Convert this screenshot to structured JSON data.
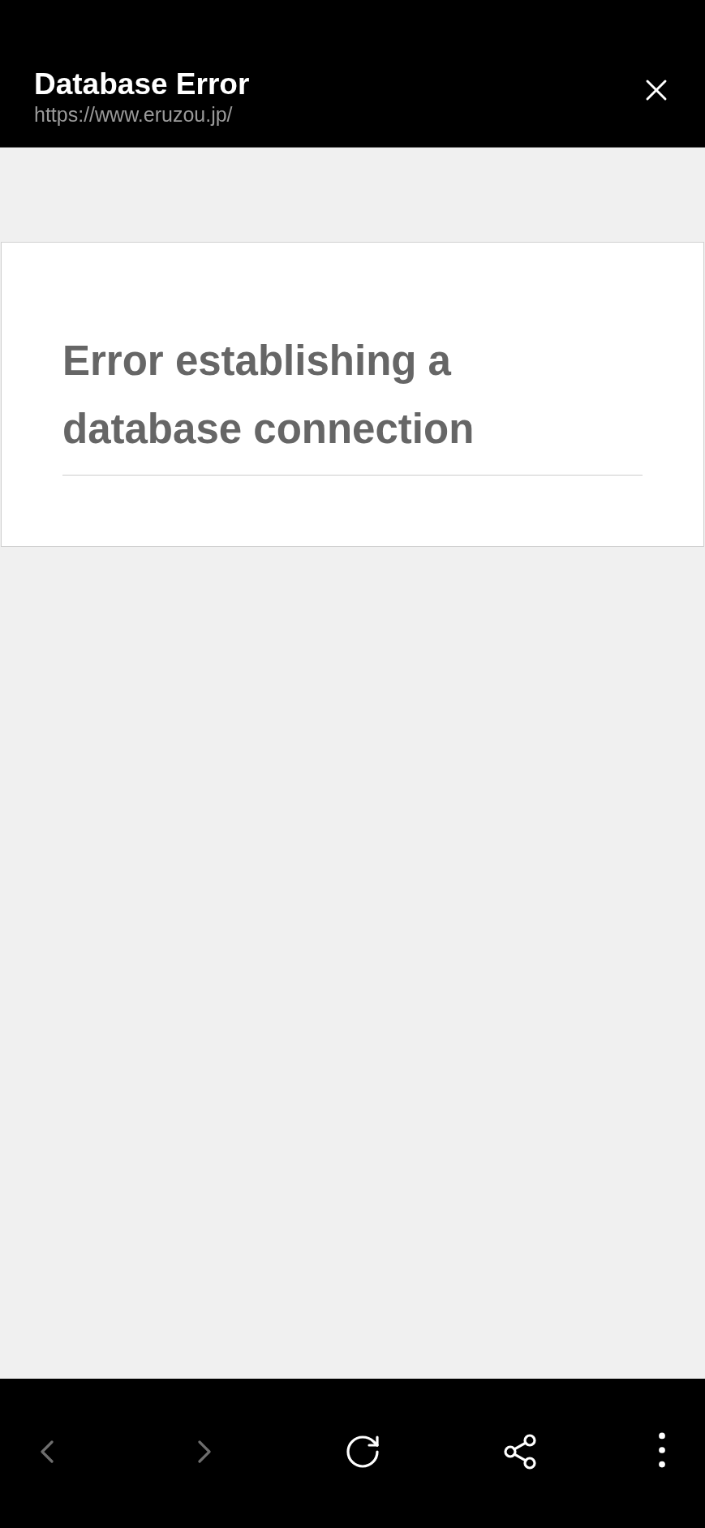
{
  "header": {
    "title": "Database Error",
    "url": "https://www.eruzou.jp/"
  },
  "page": {
    "heading": "Error establishing a database connection"
  },
  "toolbar": [
    {
      "kind": "back",
      "disabled": true
    },
    {
      "kind": "forward",
      "disabled": true
    },
    {
      "kind": "reload",
      "disabled": false
    },
    {
      "kind": "share",
      "disabled": false
    },
    {
      "kind": "more",
      "disabled": false
    }
  ]
}
